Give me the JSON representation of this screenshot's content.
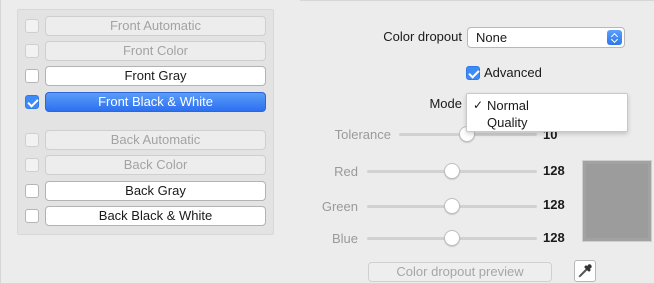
{
  "front": [
    {
      "label": "Front Automatic",
      "checked": false,
      "enabled": false,
      "selected": false
    },
    {
      "label": "Front Color",
      "checked": false,
      "enabled": false,
      "selected": false
    },
    {
      "label": "Front Gray",
      "checked": false,
      "enabled": true,
      "selected": false
    },
    {
      "label": "Front Black & White",
      "checked": true,
      "enabled": true,
      "selected": true
    }
  ],
  "back": [
    {
      "label": "Back Automatic",
      "checked": false,
      "enabled": false,
      "selected": false
    },
    {
      "label": "Back Color",
      "checked": false,
      "enabled": false,
      "selected": false
    },
    {
      "label": "Back Gray",
      "checked": false,
      "enabled": true,
      "selected": false
    },
    {
      "label": "Back Black & White",
      "checked": false,
      "enabled": true,
      "selected": false
    }
  ],
  "color_dropout": {
    "label": "Color dropout",
    "value": "None"
  },
  "advanced": {
    "label": "Advanced",
    "checked": true
  },
  "mode": {
    "label": "Mode",
    "options": [
      "Normal",
      "Quality"
    ],
    "selected": "Normal"
  },
  "tolerance": {
    "label": "Tolerance",
    "value": "10",
    "position": 0.5
  },
  "red": {
    "label": "Red",
    "value": "128",
    "position": 0.5
  },
  "green": {
    "label": "Green",
    "value": "128",
    "position": 0.5
  },
  "blue": {
    "label": "Blue",
    "value": "128",
    "position": 0.5
  },
  "preview_button": "Color dropout preview",
  "colors": {
    "accent": "#3d8bf7",
    "swatch": "#a2a2a2"
  }
}
